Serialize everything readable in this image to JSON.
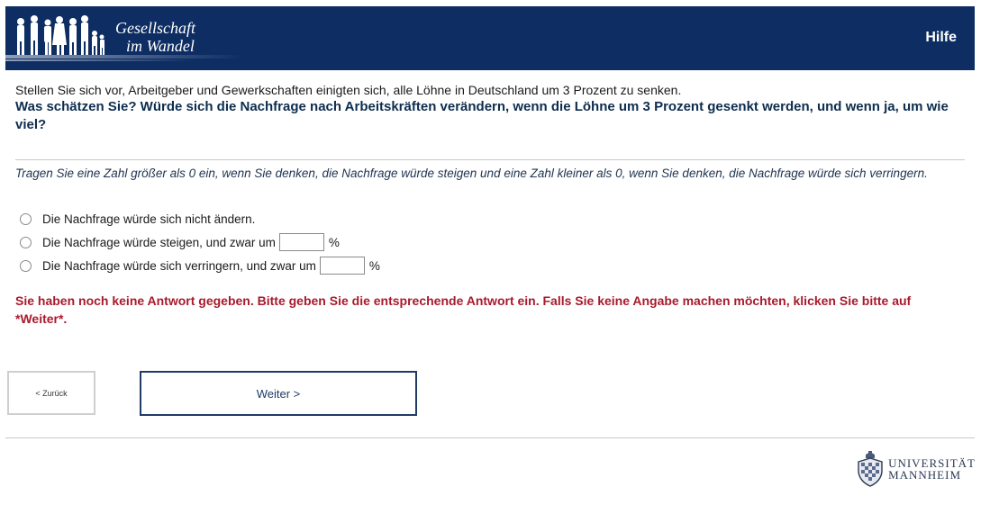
{
  "header": {
    "logo_line1": "Gesellschaft",
    "logo_line2": "im Wandel",
    "help_label": "Hilfe",
    "background": "#0d2d63"
  },
  "question": {
    "intro": "Stellen Sie sich vor, Arbeitgeber und Gewerkschaften einigten sich, alle Löhne in Deutschland um 3 Prozent zu senken.",
    "text": "Was schätzen Sie? Würde sich die Nachfrage nach Arbeitskräften verändern, wenn die Löhne um 3 Prozent gesenkt werden, und wenn ja, um wie viel?",
    "instruction": "Tragen Sie eine Zahl größer als 0 ein, wenn Sie denken, die Nachfrage würde steigen und eine Zahl kleiner als 0, wenn Sie denken, die Nachfrage würde sich verringern."
  },
  "options": [
    {
      "label": "Die Nachfrage würde sich nicht ändern."
    },
    {
      "label": "Die Nachfrage würde steigen, und zwar um",
      "value": "",
      "unit": "%"
    },
    {
      "label": "Die Nachfrage würde sich verringern, und zwar um",
      "value": "",
      "unit": "%"
    }
  ],
  "error": {
    "text": "Sie haben noch keine Antwort gegeben. Bitte geben Sie die entsprechende Antwort ein. Falls Sie keine Angabe machen möchten, klicken Sie bitte auf *Weiter*.",
    "color": "#a81a2c"
  },
  "nav": {
    "back_label": "< Zurück",
    "next_label": "Weiter >"
  },
  "footer": {
    "logo_line1": "UNIVERSITÄT",
    "logo_line2": "MANNHEIM"
  }
}
